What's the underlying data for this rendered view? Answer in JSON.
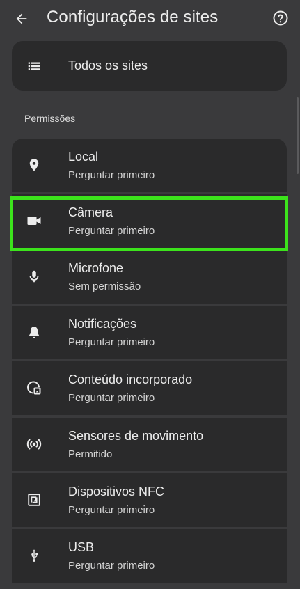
{
  "header": {
    "title": "Configurações de sites",
    "back_icon": "arrow-back-icon",
    "help_icon": "help-circle-icon"
  },
  "all_sites": {
    "label": "Todos os sites",
    "icon": "list-icon"
  },
  "section": {
    "title": "Permissões"
  },
  "permissions": [
    {
      "title": "Local",
      "status": "Perguntar primeiro",
      "icon": "location-pin-icon"
    },
    {
      "title": "Câmera",
      "status": "Perguntar primeiro",
      "icon": "videocam-icon"
    },
    {
      "title": "Microfone",
      "status": "Sem permissão",
      "icon": "microphone-icon"
    },
    {
      "title": "Notificações",
      "status": "Perguntar primeiro",
      "icon": "bell-icon"
    },
    {
      "title": "Conteúdo incorporado",
      "status": "Perguntar primeiro",
      "icon": "embedded-content-icon"
    },
    {
      "title": "Sensores de movimento",
      "status": "Permitido",
      "icon": "sensors-icon"
    },
    {
      "title": "Dispositivos NFC",
      "status": "Perguntar primeiro",
      "icon": "nfc-icon"
    },
    {
      "title": "USB",
      "status": "Perguntar primeiro",
      "icon": "usb-icon"
    }
  ],
  "colors": {
    "background": "#3a3a3c",
    "card": "#2a2a2b",
    "highlight": "#3ce31c"
  }
}
